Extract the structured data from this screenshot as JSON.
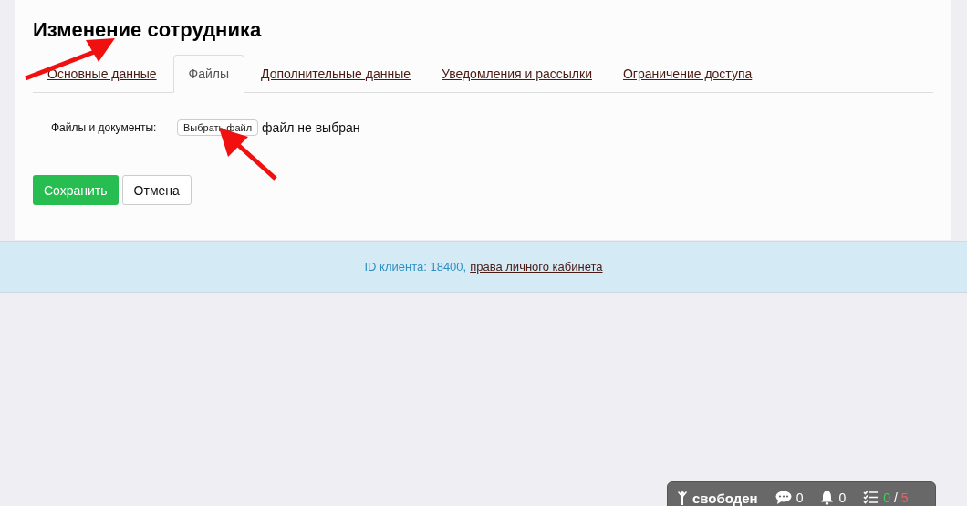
{
  "title": "Изменение сотрудника",
  "tabs": [
    {
      "label": "Основные данные",
      "selected": false
    },
    {
      "label": "Файлы",
      "selected": true
    },
    {
      "label": "Дополнительные данные",
      "selected": false
    },
    {
      "label": "Уведомления и рассылки",
      "selected": false
    },
    {
      "label": "Ограничение доступа",
      "selected": false
    }
  ],
  "files_field": {
    "label": "Файлы и документы:",
    "button": "Выбрать файл",
    "status": "файл не выбран"
  },
  "buttons": {
    "save": "Сохранить",
    "cancel": "Отмена"
  },
  "footer": {
    "client_id": "ID клиента: 18400,",
    "link": "права личного кабинета"
  },
  "status_bar": {
    "state": "свободен",
    "messages": "0",
    "notifications": "0",
    "tasks_done": "0",
    "separator": "/",
    "tasks_total": "5"
  }
}
